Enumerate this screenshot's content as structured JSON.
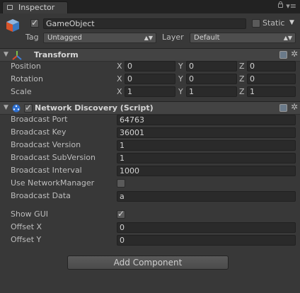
{
  "window": {
    "tab_label": "Inspector"
  },
  "gameobject": {
    "name": "GameObject",
    "static_label": "Static",
    "tag_label": "Tag",
    "tag_value": "Untagged",
    "layer_label": "Layer",
    "layer_value": "Default"
  },
  "transform": {
    "title": "Transform",
    "rows": [
      {
        "label": "Position",
        "x": "0",
        "y": "0",
        "z": "0"
      },
      {
        "label": "Rotation",
        "x": "0",
        "y": "0",
        "z": "0"
      },
      {
        "label": "Scale",
        "x": "1",
        "y": "1",
        "z": "1"
      }
    ],
    "axes": [
      "X",
      "Y",
      "Z"
    ]
  },
  "network_discovery": {
    "title": "Network Discovery (Script)",
    "broadcast_port": {
      "label": "Broadcast Port",
      "value": "64763"
    },
    "broadcast_key": {
      "label": "Broadcast Key",
      "value": "36001"
    },
    "broadcast_version": {
      "label": "Broadcast Version",
      "value": "1"
    },
    "broadcast_subversion": {
      "label": "Broadcast SubVersion",
      "value": "1"
    },
    "broadcast_interval": {
      "label": "Broadcast Interval",
      "value": "1000"
    },
    "use_network_manager": {
      "label": "Use NetworkManager",
      "checked": false
    },
    "broadcast_data": {
      "label": "Broadcast Data",
      "value": "a"
    },
    "show_gui": {
      "label": "Show GUI",
      "checked": true
    },
    "offset_x": {
      "label": "Offset X",
      "value": "0"
    },
    "offset_y": {
      "label": "Offset Y",
      "value": "0"
    }
  },
  "add_component_label": "Add Component",
  "icons": {
    "tab": "inspector-icon",
    "lock": "lock-icon",
    "menu": "menu-icon",
    "gameobject": "cube-icon",
    "transform": "transform-axes-icon",
    "script": "network-discovery-icon",
    "help": "help-icon",
    "settings": "gear-icon"
  },
  "colors": {
    "background": "#383838",
    "field": "#2a2a2a",
    "header": "#434343"
  }
}
